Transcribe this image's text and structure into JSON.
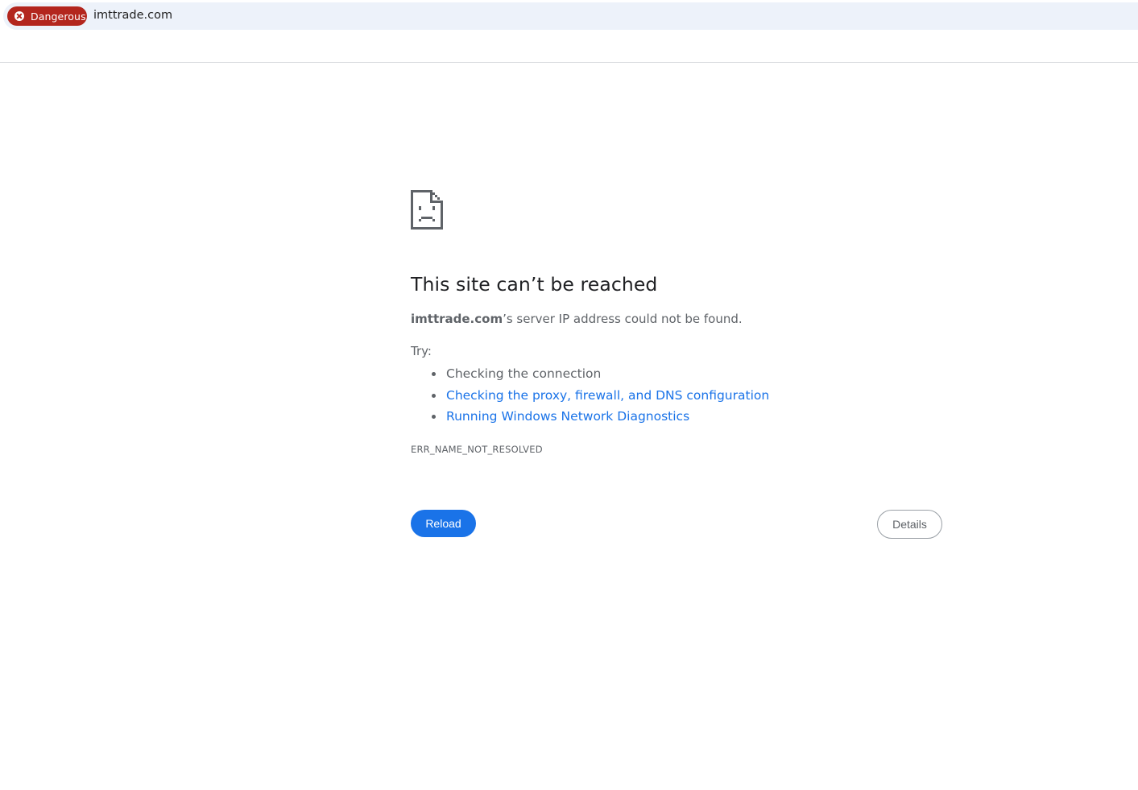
{
  "omnibox": {
    "security_chip_label": "Dangerous",
    "security_chip_icon": "error-x-icon",
    "security_chip_color": "#b3261e",
    "url": "imttrade.com"
  },
  "error_page": {
    "icon": "sad-document-icon",
    "title": "This site can’t be reached",
    "summary_host": "imttrade.com",
    "summary_rest": "’s server IP address could not be found.",
    "try_label": "Try:",
    "suggestions": [
      {
        "text": "Checking the connection",
        "is_link": false
      },
      {
        "text": "Checking the proxy, firewall, and DNS configuration",
        "is_link": true
      },
      {
        "text": "Running Windows Network Diagnostics",
        "is_link": true
      }
    ],
    "error_code": "ERR_NAME_NOT_RESOLVED",
    "reload_label": "Reload",
    "details_label": "Details",
    "accent_color": "#1a73e8"
  }
}
